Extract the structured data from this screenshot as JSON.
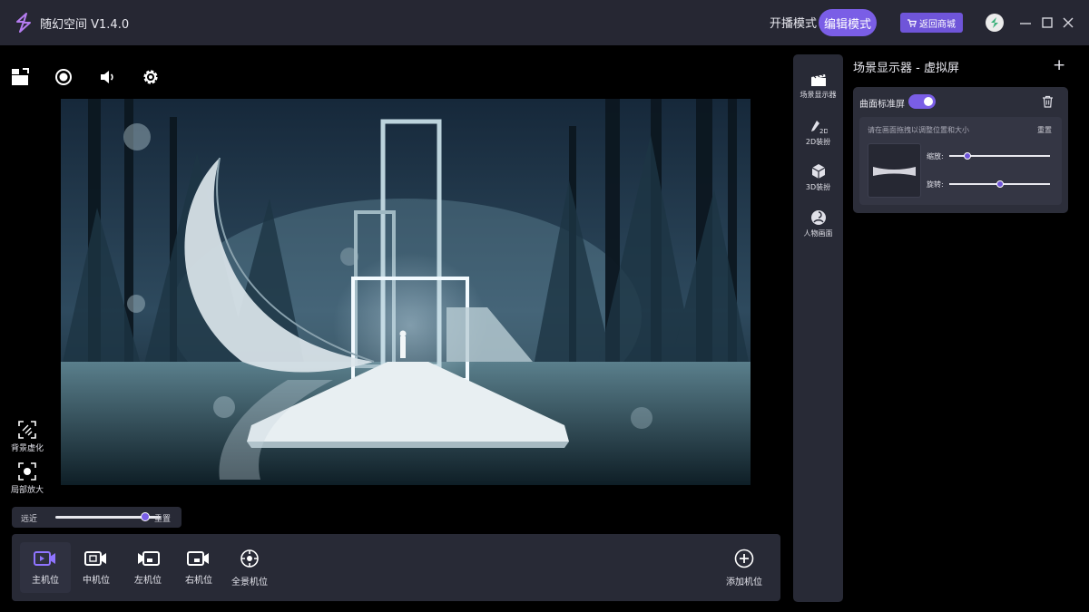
{
  "titlebar": {
    "app_title": "随幻空间 V1.4.0",
    "mode_live": "开播模式",
    "mode_edit": "编辑模式",
    "shop_button": "返回商城"
  },
  "side_tools": [
    {
      "label": "背景虚化",
      "icon": "blur-background-icon"
    },
    {
      "label": "局部放大",
      "icon": "zoom-region-icon"
    }
  ],
  "zoom": {
    "left_label": "远近",
    "reset_label": "重置",
    "value": 0.85
  },
  "cameras": [
    {
      "label": "主机位",
      "icon": "main-camera-icon",
      "active": true
    },
    {
      "label": "中机位",
      "icon": "center-camera-icon",
      "active": false
    },
    {
      "label": "左机位",
      "icon": "left-camera-icon",
      "active": false
    },
    {
      "label": "右机位",
      "icon": "right-camera-icon",
      "active": false
    },
    {
      "label": "全景机位",
      "icon": "panorama-camera-icon",
      "active": false
    }
  ],
  "add_camera_label": "添加机位",
  "right_strip": [
    {
      "label": "场景显示器",
      "icon": "clapperboard-icon"
    },
    {
      "label": "2D装扮",
      "icon": "brush-2d-icon"
    },
    {
      "label": "3D装扮",
      "icon": "cube-3d-icon"
    },
    {
      "label": "人物画面",
      "icon": "person-view-icon"
    }
  ],
  "panel": {
    "title": "场景显示器 - 虚拟屏",
    "card": {
      "name": "曲面标准屏",
      "enabled": true,
      "hint": "请在画面拖拽以调整位置和大小",
      "reset": "重置",
      "scale_label": "缩放:",
      "scale_value": 0.18,
      "rotate_label": "旋转:",
      "rotate_value": 0.5
    }
  },
  "colors": {
    "accent": "#7a5ee6",
    "panel": "#282a36",
    "titlebar": "#262733"
  }
}
